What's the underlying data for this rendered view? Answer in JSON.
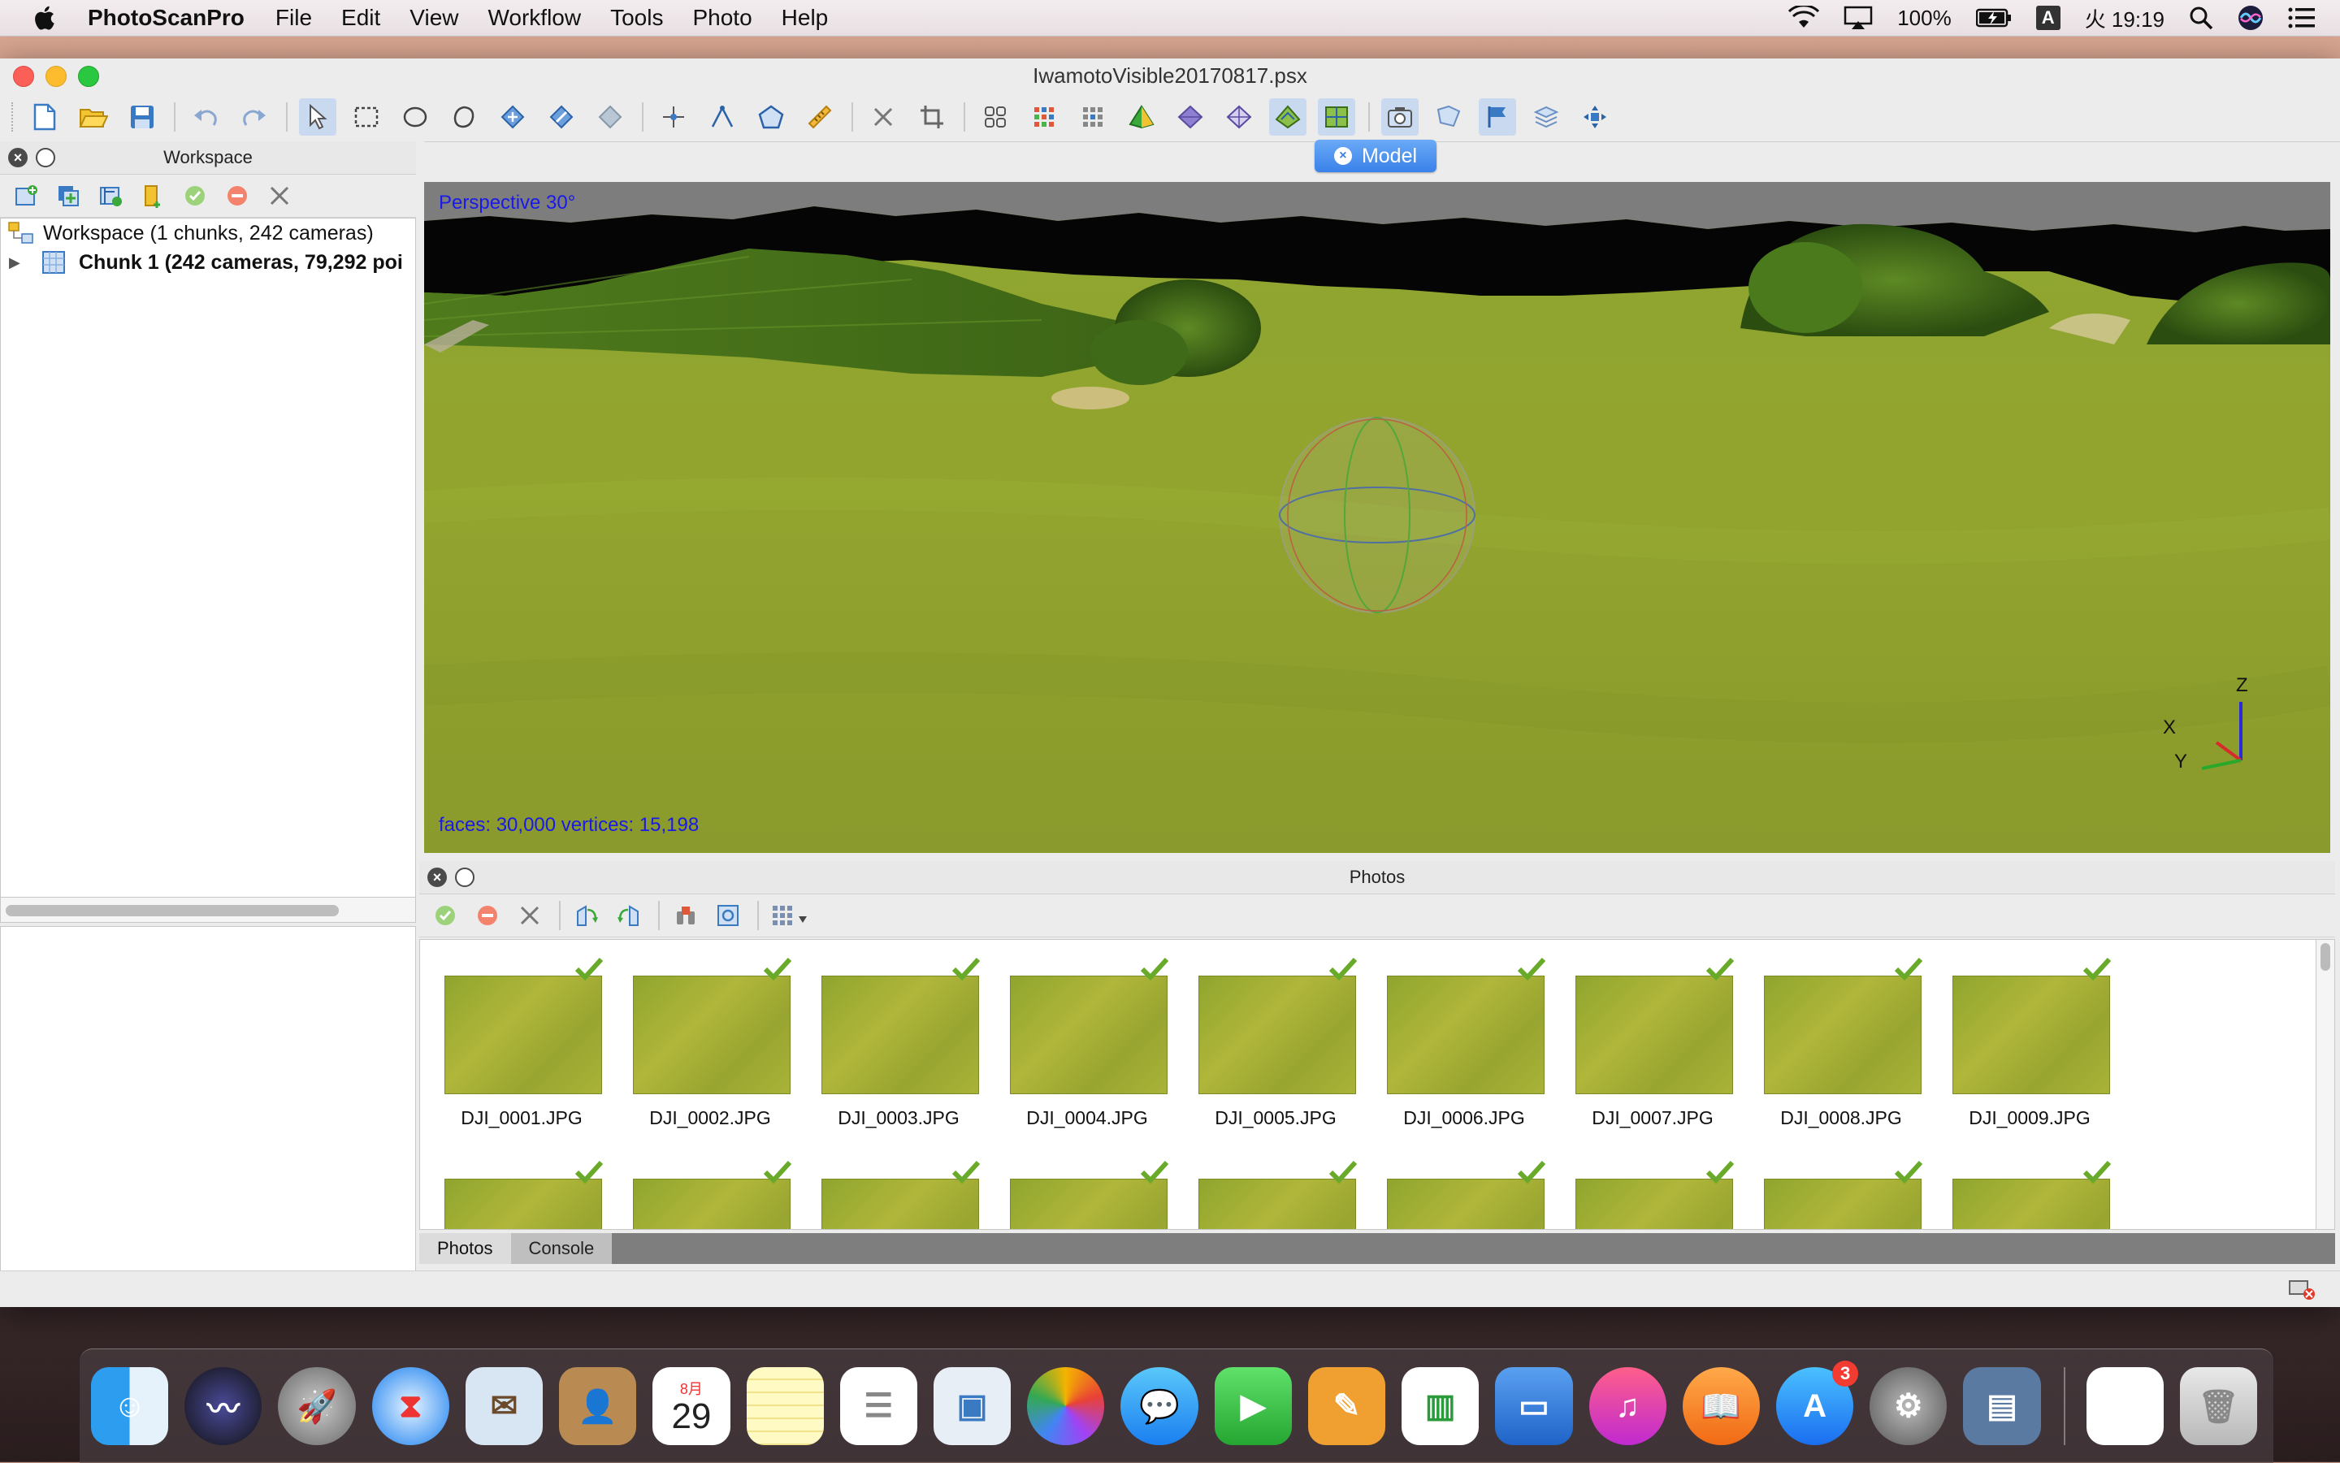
{
  "menubar": {
    "app_name": "PhotoScanPro",
    "items": [
      "File",
      "Edit",
      "View",
      "Workflow",
      "Tools",
      "Photo",
      "Help"
    ],
    "battery": "100%",
    "ime": "A",
    "clock": "火 19:19"
  },
  "window": {
    "title": "IwamotoVisible20170817.psx"
  },
  "workspace": {
    "title": "Workspace",
    "tree": {
      "root": "Workspace (1 chunks, 242 cameras)",
      "chunk": "Chunk 1 (242 cameras, 79,292 poi"
    }
  },
  "model_view": {
    "tab_label": "Model",
    "projection": "Perspective 30°",
    "stats": "faces: 30,000 vertices: 15,198",
    "axis_labels": {
      "z": "Z",
      "x": "X",
      "y": "Y"
    }
  },
  "photos": {
    "title": "Photos",
    "items": [
      {
        "name": "DJI_0001.JPG",
        "checked": true
      },
      {
        "name": "DJI_0002.JPG",
        "checked": true
      },
      {
        "name": "DJI_0003.JPG",
        "checked": true
      },
      {
        "name": "DJI_0004.JPG",
        "checked": true
      },
      {
        "name": "DJI_0005.JPG",
        "checked": true
      },
      {
        "name": "DJI_0006.JPG",
        "checked": true
      },
      {
        "name": "DJI_0007.JPG",
        "checked": true
      },
      {
        "name": "DJI_0008.JPG",
        "checked": true
      },
      {
        "name": "DJI_0009.JPG",
        "checked": true
      }
    ],
    "tabs": [
      "Photos",
      "Console"
    ],
    "active_tab": "Photos"
  },
  "dock": {
    "calendar_month": "8月",
    "calendar_day": "29",
    "appstore_badge": "3"
  }
}
